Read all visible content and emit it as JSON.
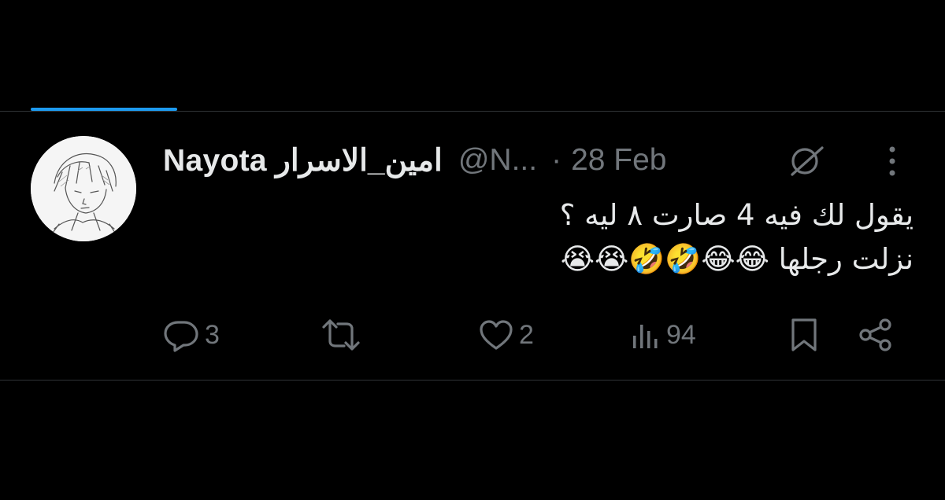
{
  "tweet": {
    "display_name": "Nayota امين_الاسرار",
    "handle": "@N...",
    "separator": "·",
    "date": "28 Feb",
    "text_lines": [
      "يقول لك فيه 4 صارت ٨ ليه ؟",
      "نزلت رجلها 😂😂🤣🤣😭😭"
    ],
    "icons": {
      "verified": "circle-slash-badge-icon",
      "more": "more-vertical-icon"
    }
  },
  "actions": {
    "reply": {
      "icon": "reply-icon",
      "count": "3"
    },
    "retweet": {
      "icon": "retweet-icon",
      "count": ""
    },
    "like": {
      "icon": "heart-icon",
      "count": "2"
    },
    "views": {
      "icon": "views-icon",
      "count": "94"
    },
    "bookmark": {
      "icon": "bookmark-icon"
    },
    "share": {
      "icon": "share-icon"
    }
  },
  "theme": {
    "background": "#000000",
    "text": "#e7e9ea",
    "muted": "#71767b",
    "accent": "#1d9bf0",
    "divider": "#2f3336"
  }
}
